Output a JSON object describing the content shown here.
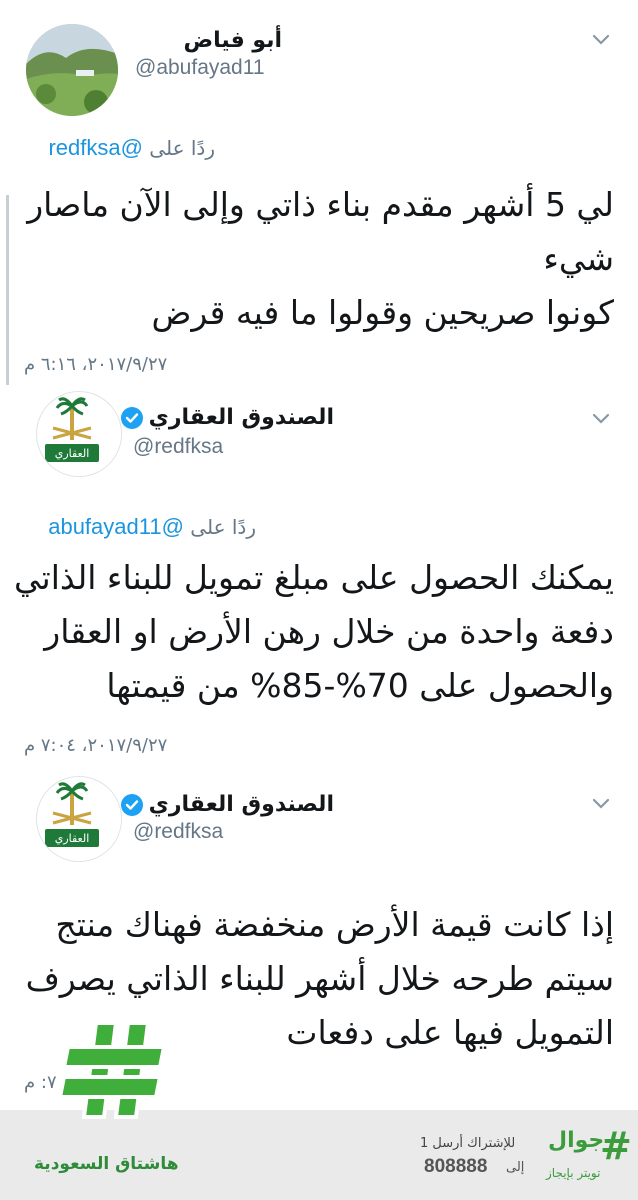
{
  "tweets": [
    {
      "display_name": "أبو فياض",
      "handle": "@abufayad11",
      "verified": false,
      "reply_prefix": "ردًا على",
      "reply_to": "@redfksa",
      "text": "لي 5 أشهر مقدم بناء ذاتي وإلى الآن  ماصار\nشيء\nكونوا صريحين وقولوا ما فيه قرض",
      "timestamp": "٢٠١٧/٩/٢٧، ٦:١٦ م"
    },
    {
      "display_name": "الصندوق العقاري",
      "handle": "@redfksa",
      "verified": true,
      "reply_prefix": "ردًا على",
      "reply_to": "@abufayad11",
      "text": "يمكنك الحصول على مبلغ تمويل للبناء الذاتي\nدفعة واحدة من خلال رهن الأرض او العقار\nوالحصول على 70%-85% من قيمتها",
      "timestamp": "٢٠١٧/٩/٢٧، ٧:٠٤ م"
    },
    {
      "display_name": "الصندوق العقاري",
      "handle": "@redfksa",
      "verified": true,
      "text": "إذا كانت قيمة الأرض منخفضة فهناك منتج\nسيتم طرحه خلال أشهر للبناء الذاتي يصرف\nالتمويل  فيها على دفعات",
      "timestamp": "٢٠١٧/٩/٢٧، ٧: م"
    }
  ],
  "emblem": {
    "text": "العقاري"
  },
  "ad_banner": {
    "hashtag_label": "هاشتاق السعودية",
    "subscribe_text": "للإشتراك أرسل 1",
    "to_label": "إلى",
    "number": "808888",
    "brand": "جوال",
    "brand_sub": "تويتر بإيجاز"
  },
  "colors": {
    "link_blue": "#1b95e0",
    "verified_blue": "#1da1f2",
    "muted_gray": "#657786",
    "hashtag_green": "#3b9c3b"
  }
}
